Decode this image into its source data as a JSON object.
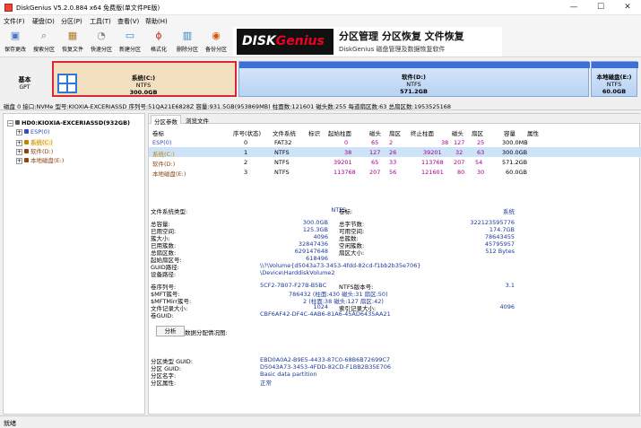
{
  "window": {
    "title": "DiskGenius V5.2.0.884 x64 免费版(单文件PE版)",
    "min": "—",
    "max": "☐",
    "close": "✕"
  },
  "menu": [
    "文件(F)",
    "硬盘(D)",
    "分区(P)",
    "工具(T)",
    "查看(V)",
    "帮助(H)"
  ],
  "toolbar": [
    {
      "label": "保存更改",
      "icon": "save-icon",
      "color": "#4a7bc0",
      "glyph": "💾"
    },
    {
      "label": "搜索分区",
      "icon": "search-partition-icon",
      "color": "#6a8f3c",
      "glyph": "🔍"
    },
    {
      "label": "恢复文件",
      "icon": "recover-file-icon",
      "color": "#b07a2a",
      "glyph": "📦"
    },
    {
      "label": "快速分区",
      "icon": "quick-partition-icon",
      "color": "#8a8a8a",
      "glyph": "◔"
    },
    {
      "label": "新建分区",
      "icon": "new-partition-icon",
      "color": "#3d7fd0",
      "glyph": "▭"
    },
    {
      "label": "格式化",
      "icon": "format-icon",
      "color": "#c0392b",
      "glyph": "ϕ"
    },
    {
      "label": "删除分区",
      "icon": "delete-partition-icon",
      "color": "#2e86c1",
      "glyph": "🗑"
    },
    {
      "label": "备份分区",
      "icon": "backup-partition-icon",
      "color": "#d35400",
      "glyph": "◉"
    }
  ],
  "banner": {
    "logo_a": "DISK",
    "logo_b": "Genius",
    "slogan": "分区管理 分区恢复 文件恢复",
    "sub": "DiskGenius 磁盘管理及数据恢复软件"
  },
  "disk_left": {
    "line1": "基本",
    "line2": "GPT"
  },
  "partitions": [
    {
      "name": "系统(C:)",
      "fs": "NTFS",
      "size": "300.0GB",
      "color": "#f0d8b4",
      "selected": true
    },
    {
      "name": "软件(D:)",
      "fs": "NTFS",
      "size": "571.2GB",
      "color": "#cfe0f8",
      "selected": false
    },
    {
      "name": "本地磁盘(E:)",
      "fs": "NTFS",
      "size": "60.0GB",
      "color": "#cfe0f8",
      "selected": false
    }
  ],
  "disk_info": "磁盘 0 接口:NVMe  型号:KIOXIA-EXCERIASSD  序列号:51QA21E6828Z  容量:931.5GB(953869MB)  柱面数:121601  磁头数:255  每道扇区数:63  总扇区数:1953525168",
  "tree": {
    "root": "HD0:KIOXIA-EXCERIASSD(932GB)",
    "items": [
      {
        "label": "ESP(0)",
        "color": "#3050c0"
      },
      {
        "label": "系统(C:)",
        "color": "#c08000"
      },
      {
        "label": "软件(D:)",
        "color": "#8b4513"
      },
      {
        "label": "本地磁盘(E:)",
        "color": "#8b4513"
      }
    ]
  },
  "tabs": [
    "分区参数",
    "浏览文件"
  ],
  "table": {
    "headers": [
      "卷标",
      "序号(状态)",
      "文件系统",
      "标识",
      "起始柱面",
      "磁头",
      "扇区",
      "终止柱面",
      "磁头",
      "扇区",
      "容量",
      "属性"
    ],
    "rows": [
      {
        "label": "ESP(0)",
        "no": "0",
        "fs": "FAT32",
        "id": "",
        "sc": "0",
        "sh": "65",
        "ss": "2",
        "ec": "38",
        "eh": "127",
        "es": "25",
        "cap": "300.0MB",
        "attr": ""
      },
      {
        "label": "系统(C:)",
        "no": "1",
        "fs": "NTFS",
        "id": "",
        "sc": "38",
        "sh": "127",
        "ss": "26",
        "ec": "39201",
        "eh": "32",
        "es": "63",
        "cap": "300.0GB",
        "attr": ""
      },
      {
        "label": "软件(D:)",
        "no": "2",
        "fs": "NTFS",
        "id": "",
        "sc": "39201",
        "sh": "65",
        "ss": "33",
        "ec": "113768",
        "eh": "207",
        "es": "54",
        "cap": "571.2GB",
        "attr": ""
      },
      {
        "label": "本地磁盘(E:)",
        "no": "3",
        "fs": "NTFS",
        "id": "",
        "sc": "113768",
        "sh": "207",
        "ss": "56",
        "ec": "121601",
        "eh": "80",
        "es": "30",
        "cap": "60.0GB",
        "attr": ""
      }
    ]
  },
  "info": {
    "fstype_label": "文件系统类型:",
    "fstype": "NTFS",
    "vol_label": "卷标:",
    "vol": "系统",
    "left": [
      {
        "k": "总容量:",
        "v": "300.0GB"
      },
      {
        "k": "已用空间:",
        "v": "125.3GB"
      },
      {
        "k": "簇大小:",
        "v": "4096"
      },
      {
        "k": "已用簇数:",
        "v": "32847436"
      },
      {
        "k": "总扇区数:",
        "v": "629147648"
      },
      {
        "k": "起始扇区号:",
        "v": "618496"
      },
      {
        "k": "GUID路径:",
        "v": "\\\\?\\Volume{d5043a73-3453-4fdd-82cd-f1bb2b35e706}"
      },
      {
        "k": "设备路径:",
        "v": "\\Device\\HarddiskVolume2"
      }
    ],
    "right": [
      {
        "k": "总字节数:",
        "v": "322123595776"
      },
      {
        "k": "可用空间:",
        "v": "174.7GB"
      },
      {
        "k": "总簇数:",
        "v": "78643455"
      },
      {
        "k": "空闲簇数:",
        "v": "45795957"
      },
      {
        "k": "扇区大小:",
        "v": "512 Bytes"
      }
    ],
    "serial_k": "卷序列号:",
    "serial_v": "5CF2-7B07-F27B-B5BC",
    "ntfsver_k": "NTFS版本号:",
    "ntfsver_v": "3.1",
    "mft_k": "$MFT簇号:",
    "mft_v": "786432 (柱面:430 磁头:31 扇区:50)",
    "mftmirr_k": "$MFTMirr簇号:",
    "mftmirr_v": "2 (柱面:38 磁头:127 扇区:42)",
    "frs_k": "文件记录大小:",
    "frs_v": "1024",
    "idx_k": "索引记录大小:",
    "idx_v": "4096",
    "volguid_k": "卷GUID:",
    "volguid_v": "CBF6AF42-DF4C-4AB6-81A6-45AD6435AA21",
    "analyze_btn": "分析",
    "analyze_label": "数据分配情况图:",
    "ptype_k": "分区类型 GUID:",
    "ptype_v": "EBD0A0A2-B9E5-4433-87C0-68B6B72699C7",
    "pguid_k": "分区 GUID:",
    "pguid_v": "D5043A73-3453-4FDD-82CD-F1BB2B35E706",
    "pname_k": "分区名字:",
    "pname_v": "Basic data partition",
    "pattr_k": "分区属性:",
    "pattr_v": "正常"
  },
  "status": "就绪"
}
